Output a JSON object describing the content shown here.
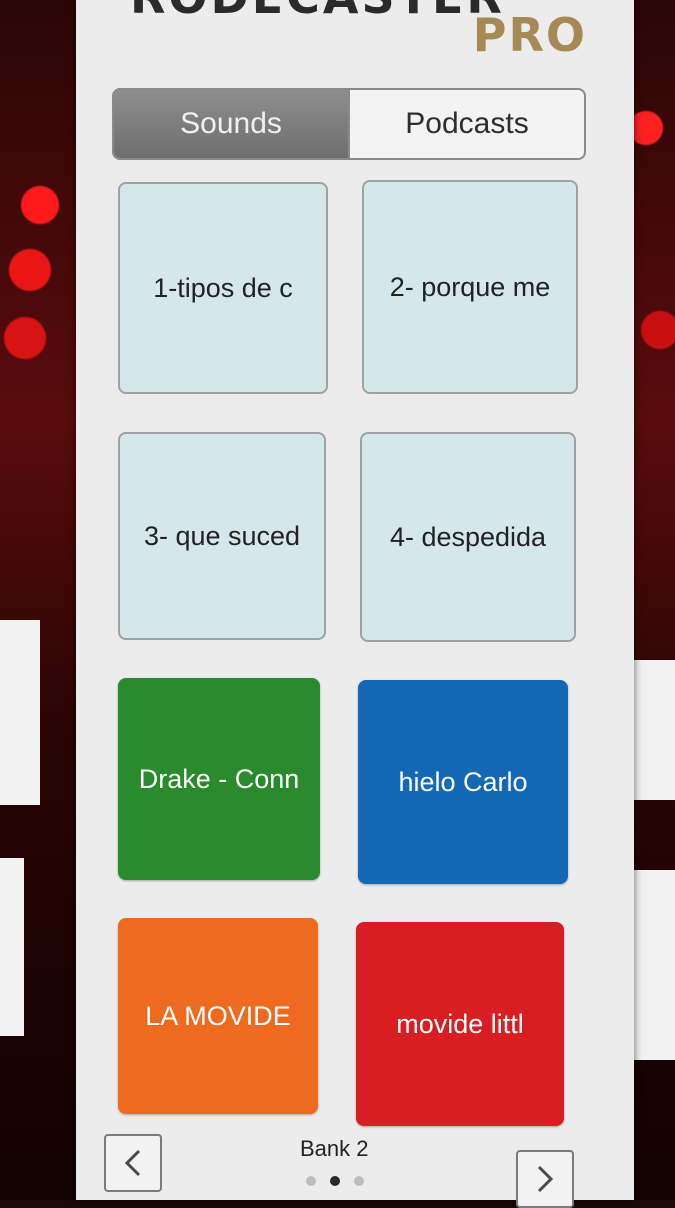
{
  "header": {
    "brand_top": "RODECASTER",
    "brand_pro": "PRO"
  },
  "tabs": [
    {
      "label": "Sounds",
      "active": true
    },
    {
      "label": "Podcasts",
      "active": false
    }
  ],
  "pads": [
    {
      "label": "1-tipos de c",
      "color": "#d6e7ec",
      "type": "empty"
    },
    {
      "label": "2- porque me",
      "color": "#d6e7ec",
      "type": "empty"
    },
    {
      "label": "3- que suced",
      "color": "#d6e7ec",
      "type": "empty"
    },
    {
      "label": "4- despedida",
      "color": "#d6e7ec",
      "type": "empty"
    },
    {
      "label": "Drake - Conn",
      "color": "#2a8a2e",
      "type": "color"
    },
    {
      "label": "hielo Carlo",
      "color": "#1468b4",
      "type": "color"
    },
    {
      "label": "LA MOVIDE",
      "color": "#ee6a1e",
      "type": "color"
    },
    {
      "label": "movide littl",
      "color": "#d81e22",
      "type": "color"
    }
  ],
  "footer": {
    "bank_label": "Bank 2",
    "prev_icon": "chevron-left-icon",
    "next_icon": "chevron-right-icon",
    "page_count": 3,
    "current_page": 2
  }
}
